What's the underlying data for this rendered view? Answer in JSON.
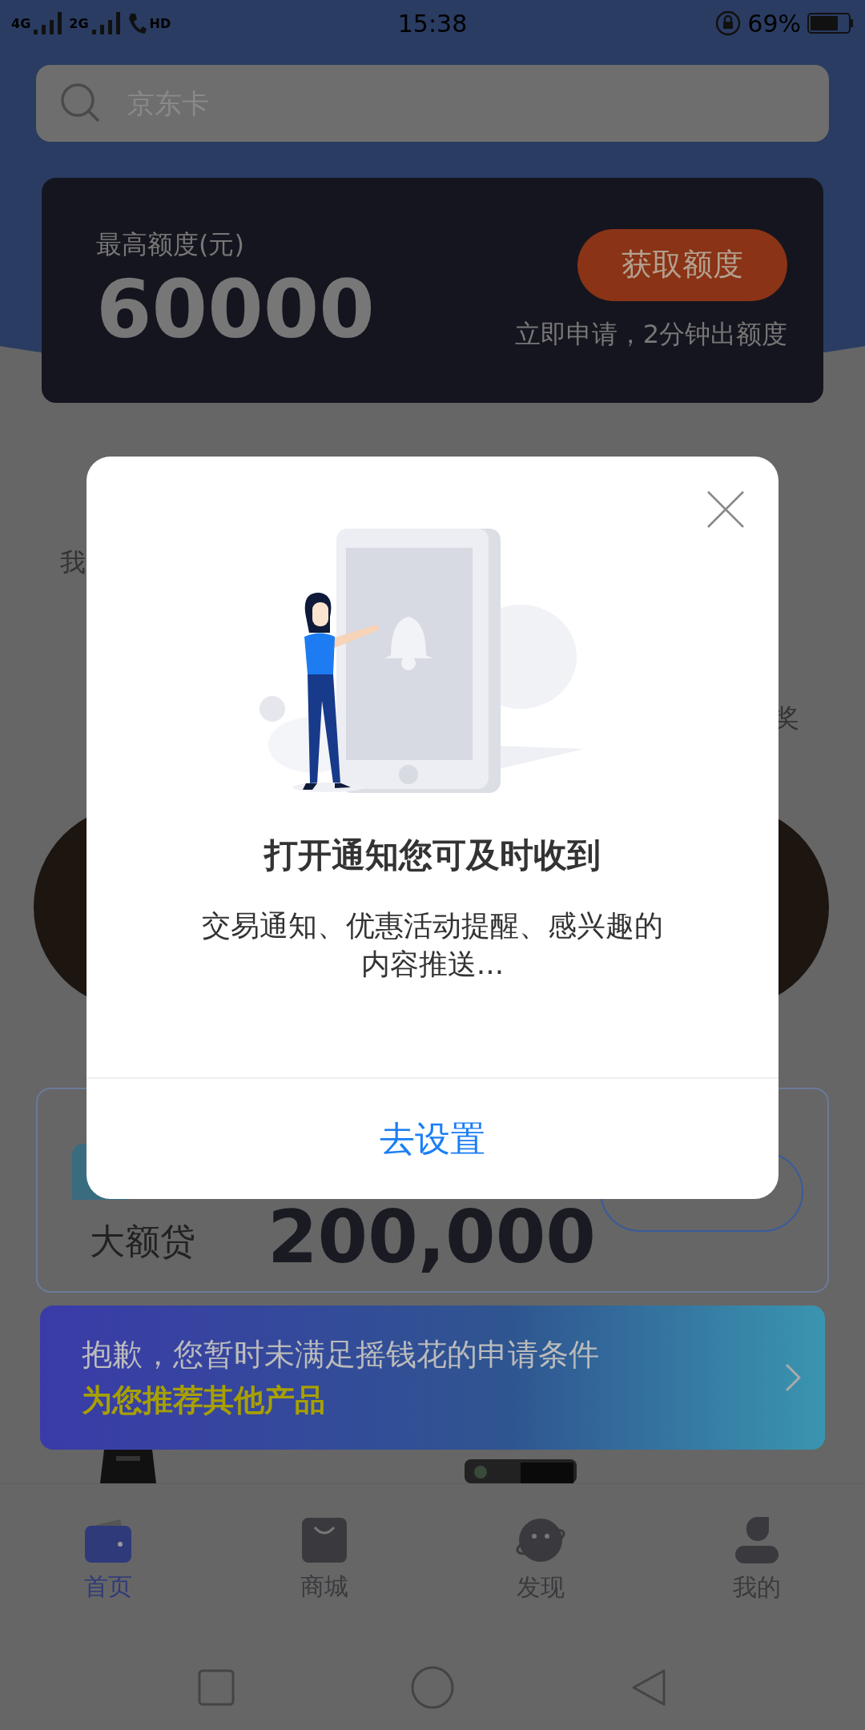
{
  "status_bar": {
    "network_1": "4G",
    "network_2": "2G",
    "hd": "HD",
    "time": "15:38",
    "battery": "69%"
  },
  "search": {
    "placeholder": "京东卡"
  },
  "credit_card": {
    "label": "最高额度(元)",
    "amount": "60000",
    "button": "获取额度",
    "note": "立即申请，2分钟出额度"
  },
  "background_fragments": {
    "left": "我",
    "right": "奖"
  },
  "loan_card": {
    "name": "大额贷",
    "amount": "200,000"
  },
  "toast": {
    "message": "抱歉，您暂时未满足摇钱花的申请条件",
    "link": "为您推荐其他产品"
  },
  "tabs": [
    {
      "label": "首页",
      "kind": "wallet",
      "selected": true
    },
    {
      "label": "商城",
      "kind": "bag",
      "selected": false
    },
    {
      "label": "发现",
      "kind": "planet",
      "selected": false
    },
    {
      "label": "我的",
      "kind": "person",
      "selected": false
    }
  ],
  "dialog": {
    "title": "打开通知您可及时收到",
    "body": "交易通知、优惠活动提醒、感兴趣的内容推送...",
    "button": "去设置"
  }
}
